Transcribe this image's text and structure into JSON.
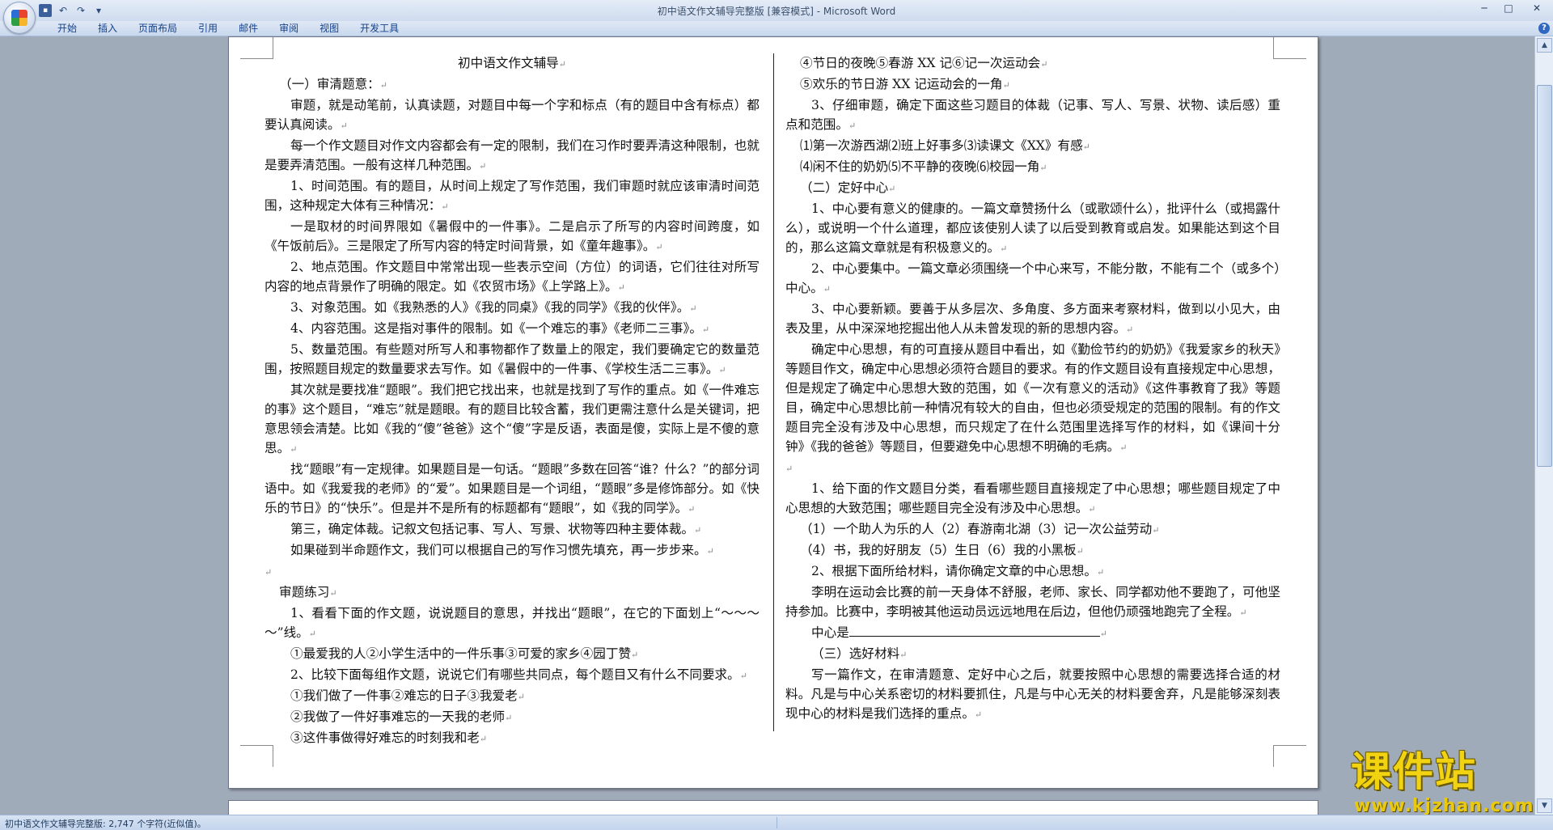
{
  "window": {
    "title": "初中语文作文辅导完整版 [兼容模式] - Microsoft Word",
    "controls": {
      "minimize": "─",
      "maximize": "□",
      "close": "✕"
    }
  },
  "qat": {
    "save": "💾",
    "undo": "↶",
    "redo": "↷",
    "more": "▾"
  },
  "ribbon": {
    "tabs": [
      "开始",
      "插入",
      "页面布局",
      "引用",
      "邮件",
      "审阅",
      "视图",
      "开发工具"
    ],
    "help": "?"
  },
  "document": {
    "left": [
      "初中语文作文辅导",
      "（一）审清题意：",
      "审题，就是动笔前，认真读题，对题目中每一个字和标点（有的题目中含有标点）都要认真阅读。",
      "每一个作文题目对作文内容都会有一定的限制，我们在习作时要弄清这种限制，也就是要弄清范围。一般有这样几种范围。",
      "1、时间范围。有的题目，从时间上规定了写作范围，我们审题时就应该审清时间范围，这种规定大体有三种情况：",
      "一是取材的时间界限如《暑假中的一件事》。二是启示了所写的内容时间跨度，如《午饭前后》。三是限定了所写内容的特定时间背景，如《童年趣事》。",
      "2、地点范围。作文题目中常常出现一些表示空间（方位）的词语，它们往往对所写内容的地点背景作了明确的限定。如《农贸市场》《上学路上》。",
      "3、对象范围。如《我熟悉的人》《我的同桌》《我的同学》《我的伙伴》。",
      "4、内容范围。这是指对事件的限制。如《一个难忘的事》《老师二三事》。",
      "5、数量范围。有些题对所写人和事物都作了数量上的限定，我们要确定它的数量范围，按照题目规定的数量要求去写作。如《暑假中的一件事、《学校生活二三事》。",
      "其次就是要找准“题眼”。我们把它找出来，也就是找到了写作的重点。如《一件难忘的事》这个题目，“难忘”就是题眼。有的题目比较含蓄，我们更需注意什么是关键词，把意思领会清楚。比如《我的“傻”爸爸》这个“傻”字是反语，表面是傻，实际上是不傻的意思。",
      "找“题眼”有一定规律。如果题目是一句话。“题眼”多数在回答“谁？什么？”的部分词语中。如《我爱我的老师》的“爱”。如果题目是一个词组，“题眼”多是修饰部分。如《快乐的节日》的“快乐”。但是并不是所有的标题都有“题眼”，如《我的同学》。",
      "第三，确定体裁。记叙文包括记事、写人、写景、状物等四种主要体裁。",
      "如果碰到半命题作文，我们可以根据自己的写作习惯先填充，再一步步来。",
      "",
      "审题练习",
      "1、看看下面的作文题，说说题目的意思，并找出“题眼”，在它的下面划上“～～～～”线。",
      "①最爱我的人②小学生活中的一件乐事③可爱的家乡④园丁赞",
      "2、比较下面每组作文题，说说它们有哪些共同点，每个题目又有什么不同要求。",
      "①我们做了一件事②难忘的日子③我爱老",
      "②我做了一件好事难忘的一天我的老师",
      "③这件事做得好难忘的时刻我和老"
    ],
    "right": [
      "④节日的夜晚⑤春游 XX 记⑥记一次运动会",
      "⑤欢乐的节日游 XX 记运动会的一角",
      "3、仔细审题，确定下面这些习题目的体裁（记事、写人、写景、状物、读后感）重点和范围。",
      "⑴第一次游西湖⑵班上好事多⑶读课文《XX》有感",
      "⑷闲不住的奶奶⑸不平静的夜晚⑹校园一角",
      "（二）定好中心",
      "1、中心要有意义的健康的。一篇文章赞扬什么（或歌颂什么），批评什么（或揭露什么），或说明一个什么道理，都应该使别人读了以后受到教育或启发。如果能达到这个目的，那么这篇文章就是有积极意义的。",
      "2、中心要集中。一篇文章必须围绕一个中心来写，不能分散，不能有二个（或多个）中心。",
      "3、中心要新颖。要善于从多层次、多角度、多方面来考察材料，做到以小见大，由表及里，从中深深地挖掘出他人从未曾发现的新的思想内容。",
      "确定中心思想，有的可直接从题目中看出，如《勤俭节约的奶奶》《我爱家乡的秋天》等题目作文，确定中心思想必须符合题目的要求。有的作文题目设有直接规定中心思想，但是规定了确定中心思想大致的范围，如《一次有意义的活动》《这件事教育了我》等题目，确定中心思想比前一种情况有较大的自由，但也必须受规定的范围的限制。有的作文题目完全没有涉及中心思想，而只规定了在什么范围里选择写作的材料，如《课间十分钟》《我的爸爸》等题目，但要避免中心思想不明确的毛病。",
      "",
      "1、给下面的作文题目分类，看看哪些题目直接规定了中心思想；哪些题目规定了中心思想的大致范围；哪些题目完全没有涉及中心思想。",
      "（1）一个助人为乐的人（2）春游南北湖（3）记一次公益劳动",
      "（4）书，我的好朋友（5）生日（6）我的小黑板",
      "2、根据下面所给材料，请你确定文章的中心思想。",
      "李明在运动会比赛的前一天身体不舒服，老师、家长、同学都劝他不要跑了，可他坚持参加。比赛中，李明被其他运动员远远地甩在后边，但他仍顽强地跑完了全程。",
      "中心是",
      "（三）选好材料",
      "写一篇作文，在审清题意、定好中心之后，就要按照中心思想的需要选择合适的材料。凡是与中心关系密切的材料要抓住，凡是与中心无关的材料要舍弃，凡是能够深刻表现中心的材料是我们选择的重点。"
    ]
  },
  "paragraph_mark": "↵",
  "statusbar": {
    "text": "初中语文作文辅导完整版: 2,747 个字符(近似值)。"
  },
  "scrollbar": {
    "up": "▲",
    "down": "▼"
  },
  "watermark": {
    "title": "课件站",
    "url": "www.kjzhan.com"
  }
}
